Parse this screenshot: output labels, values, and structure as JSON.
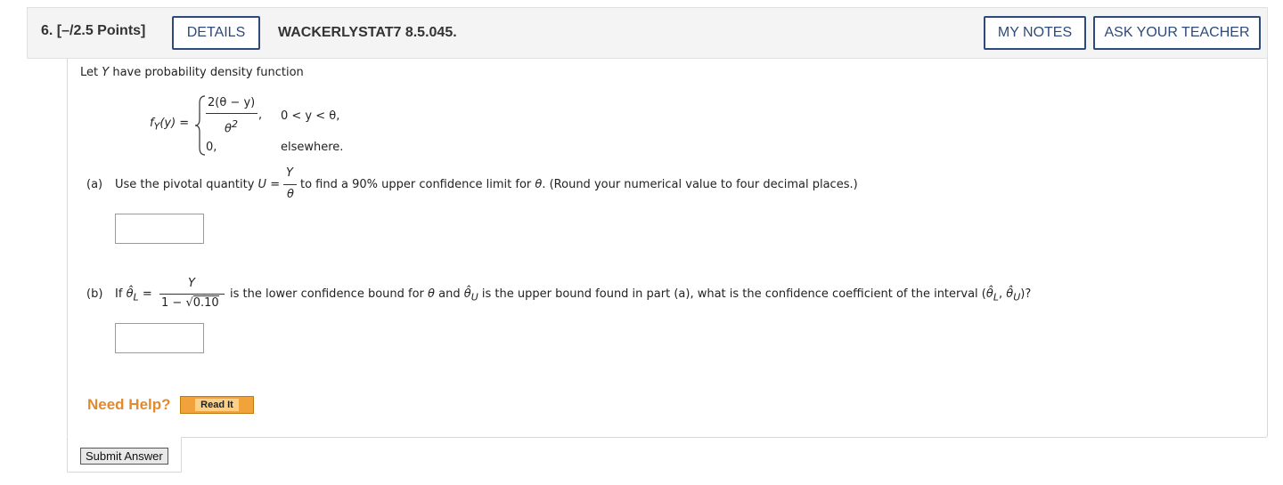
{
  "header": {
    "question_number": "6.",
    "points": "[–/2.5 Points]",
    "details_label": "DETAILS",
    "question_id": "WACKERLYSTAT7 8.5.045.",
    "my_notes_label": "MY NOTES",
    "ask_teacher_label": "ASK YOUR TEACHER"
  },
  "question": {
    "intro": [
      "Let ",
      "Y",
      " have probability density function"
    ],
    "pdf": {
      "lhs_f": "f",
      "lhs_sub": "Y",
      "lhs_arg": "(y) =",
      "case1_num": "2(θ − y)",
      "case1_den": "θ",
      "case1_den_exp": "2",
      "case1_comma": ",",
      "case1_cond": "0 < y < θ,",
      "case2_val": "0,",
      "case2_cond": "elsewhere."
    },
    "part_a": {
      "label": "(a)",
      "text_before": "Use the pivotal quantity ",
      "U": "U",
      "eq": "=",
      "num": "Y",
      "den": "θ",
      "text_after": " to find a 90% upper confidence limit for ",
      "theta": "θ",
      "text_end": ". (Round your numerical value to four decimal places.)",
      "answer_value": ""
    },
    "part_b": {
      "label": "(b)",
      "if": "If",
      "theta_hat": "θ̂",
      "sub_L": "L",
      "eq": "=",
      "num": "Y",
      "den_pre": "1 − ",
      "sqrt_symbol": "√",
      "sqrt_val": "0.10",
      "text1": "is the lower confidence bound for ",
      "theta": "θ",
      "and": " and ",
      "sub_U": "U",
      "text2": " is the upper bound found in part (a), what is the confidence coefficient of the interval (",
      "comma": ", ",
      "close": ")?",
      "answer_value": ""
    }
  },
  "help": {
    "need_help": "Need Help?",
    "read_it": "Read It"
  },
  "submit_label": "Submit Answer"
}
